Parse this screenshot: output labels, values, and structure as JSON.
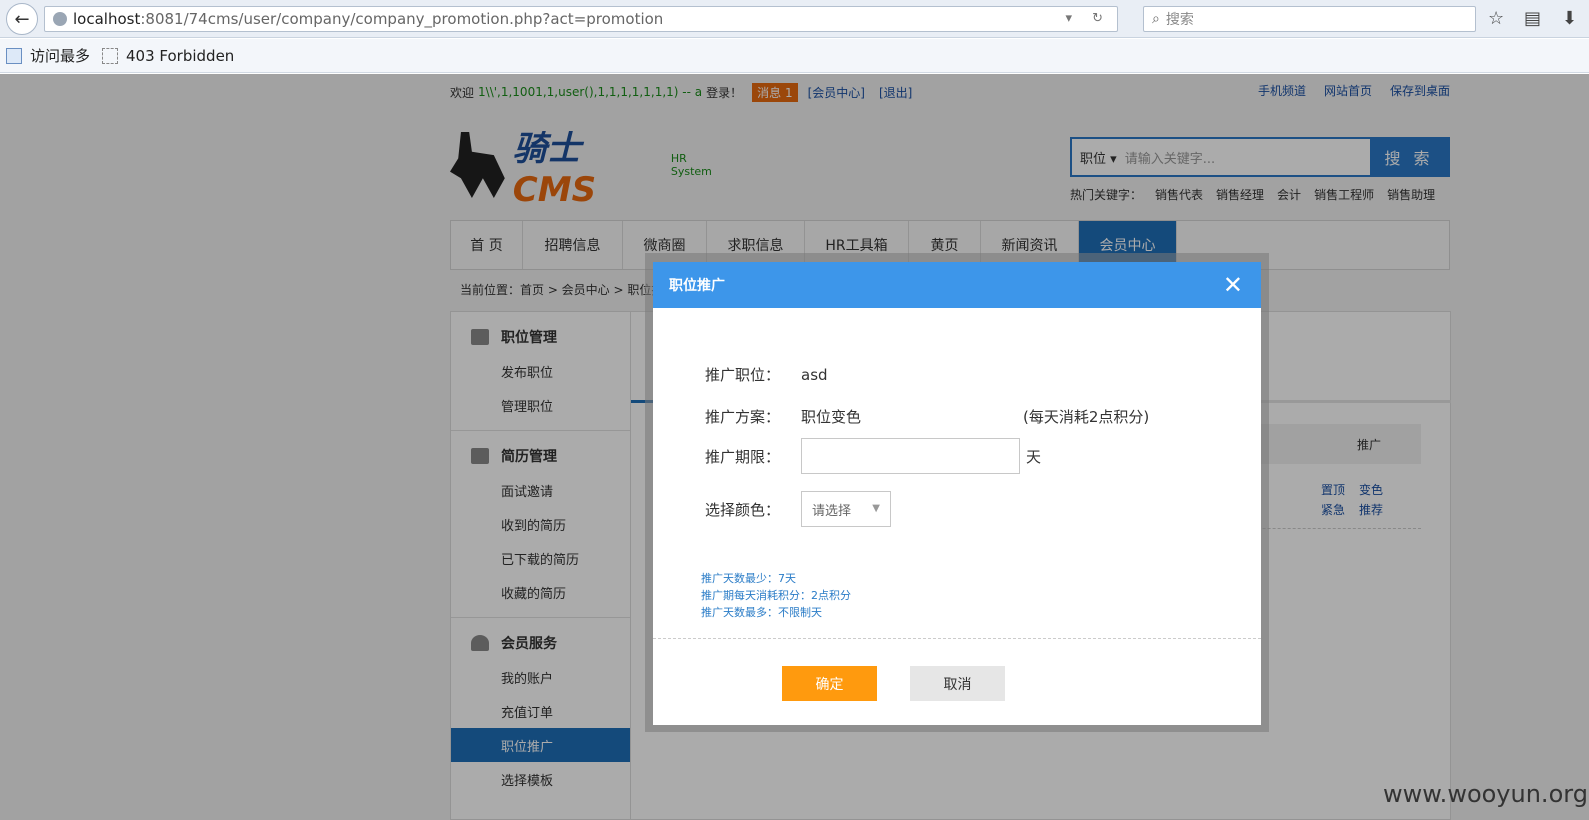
{
  "browser": {
    "url_host": "localhost",
    "url_rest": ":8081/74cms/user/company/company_promotion.php?act=promotion",
    "search_placeholder": "搜索",
    "bookmarks": [
      "访问最多",
      "403 Forbidden"
    ]
  },
  "topbar": {
    "welcome": "欢迎",
    "username": "1\\\\',1,1001,1,user(),1,1,1,1,1,1,1) -- a",
    "logged_in": "登录！",
    "message_badge": "消息 1",
    "member_center_link": "[会员中心]",
    "logout_link": "[退出]",
    "right_links": [
      "手机频道",
      "网站首页",
      "保存到桌面"
    ]
  },
  "logo": {
    "brand_main": "骑士",
    "brand_cms": "CMS",
    "sub": "HR System"
  },
  "site_search": {
    "category": "职位",
    "placeholder": "请输入关键字...",
    "button": "搜 索",
    "hot_label": "热门关键字：",
    "hot_words": [
      "销售代表",
      "销售经理",
      "会计",
      "销售工程师",
      "销售助理"
    ]
  },
  "nav": [
    "首 页",
    "招聘信息",
    "微商圈",
    "求职信息",
    "HR工具箱",
    "黄页",
    "新闻资讯",
    "会员中心"
  ],
  "breadcrumb": "当前位置：首页 > 会员中心 > 职位推",
  "sidebar": [
    {
      "title": "职位管理",
      "items": [
        "发布职位",
        "管理职位"
      ]
    },
    {
      "title": "简历管理",
      "items": [
        "面试邀请",
        "收到的简历",
        "已下载的简历",
        "收藏的简历"
      ]
    },
    {
      "title": "会员服务",
      "items": [
        "我的账户",
        "充值订单",
        "职位推广",
        "选择模板"
      ]
    }
  ],
  "main": {
    "col_header": "推广",
    "ops_row1": [
      "置顶",
      "变色"
    ],
    "ops_row2": [
      "紧急",
      "推荐"
    ]
  },
  "dialog": {
    "title": "职位推广",
    "close": "✕",
    "job_label": "推广职位：",
    "job_value": "asd",
    "plan_label": "推广方案：",
    "plan_value": "职位变色",
    "plan_note": "(每天消耗2点积分)",
    "days_label": "推广期限：",
    "days_value": "",
    "days_unit": "天",
    "color_label": "选择颜色：",
    "color_select": "请选择",
    "tips": [
      "推广天数最少：7天",
      "推广期每天消耗积分：2点积分",
      "推广天数最多：不限制天"
    ],
    "ok": "确定",
    "cancel": "取消"
  },
  "watermark": "www.wooyun.org"
}
